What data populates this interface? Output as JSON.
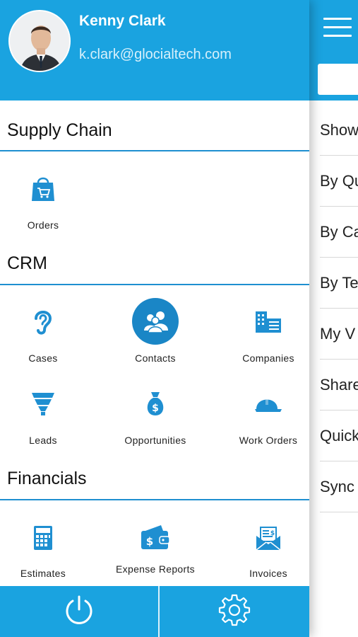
{
  "profile": {
    "name": "Kenny Clark",
    "email": "k.clark@glocialtech.com"
  },
  "sections": {
    "supply_chain": {
      "title": "Supply Chain",
      "items": [
        {
          "label": "Orders",
          "icon": "shopping-bag-icon"
        }
      ]
    },
    "crm": {
      "title": "CRM",
      "items": [
        {
          "label": "Cases",
          "icon": "ear-icon"
        },
        {
          "label": "Contacts",
          "icon": "people-icon"
        },
        {
          "label": "Companies",
          "icon": "buildings-icon"
        },
        {
          "label": "Leads",
          "icon": "funnel-icon"
        },
        {
          "label": "Opportunities",
          "icon": "money-bag-icon"
        },
        {
          "label": "Work Orders",
          "icon": "hard-hat-icon"
        }
      ]
    },
    "financials": {
      "title": "Financials",
      "items": [
        {
          "label": "Estimates",
          "icon": "calculator-icon"
        },
        {
          "label": "Expense Reports",
          "icon": "wallet-icon"
        },
        {
          "label": "Invoices",
          "icon": "invoice-envelope-icon"
        }
      ]
    }
  },
  "bottom_bar": {
    "left_icon": "power-icon",
    "right_icon": "gear-icon"
  },
  "right_panel": {
    "items": [
      "Show",
      "By Qu",
      "By Ca",
      "By Te",
      "My V",
      "Share",
      "Quick",
      "Sync"
    ]
  },
  "colors": {
    "primary": "#1aa3e0",
    "icon": "#1f8fd1",
    "divider": "#1e8fd0"
  }
}
